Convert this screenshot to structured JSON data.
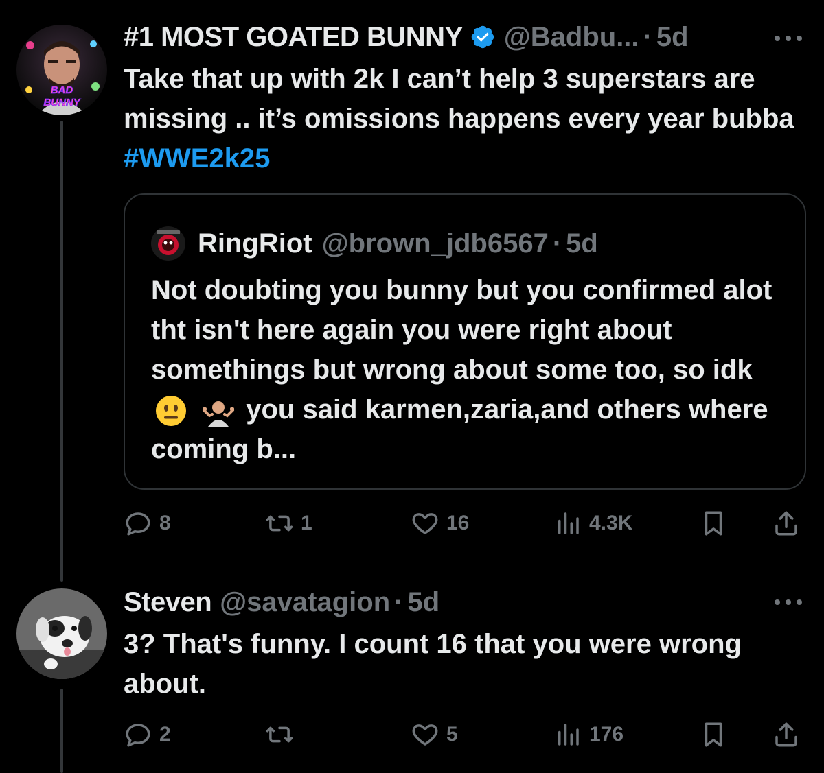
{
  "tweet": {
    "display_name": "#1 MOST GOATED BUNNY",
    "handle": "@Badbu...",
    "separator": "·",
    "time": "5d",
    "text_before": "Take that up with 2k I can’t help 3 superstars are missing .. it’s omissions happens every year bubba ",
    "hashtag": "#WWE2k25",
    "avatar_logo_text": [
      "BAD",
      "BUNNY"
    ],
    "quote": {
      "display_name": "RingRiot",
      "handle": "@brown_jdb6567",
      "separator": "·",
      "time": "5d",
      "text_part1": "Not doubting you bunny but you confirmed alot tht isn't here again you were right about somethings but wrong about some too, so idk",
      "text_part2": "you said karmen,zaria,and others where coming b..."
    },
    "actions": {
      "replies": "8",
      "reposts": "1",
      "likes": "16",
      "views": "4.3K"
    }
  },
  "reply": {
    "display_name": "Steven",
    "handle": "@savatagion",
    "separator": "·",
    "time": "5d",
    "text": "3? That's funny. I count 16 that you were wrong about.",
    "actions": {
      "replies": "2",
      "reposts": "",
      "likes": "5",
      "views": "176"
    }
  },
  "colors": {
    "background": "#000000",
    "text": "#e7e9ea",
    "muted": "#71767b",
    "accent": "#1d9bf0",
    "border": "#2f3336"
  }
}
